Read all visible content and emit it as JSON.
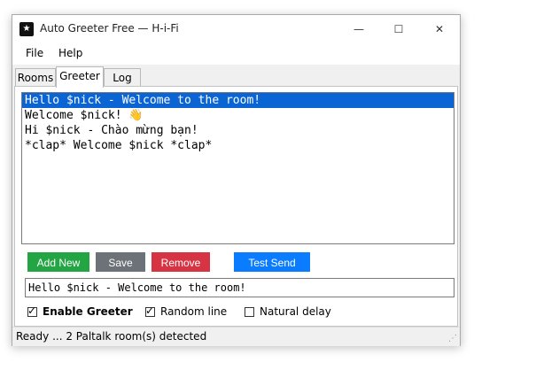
{
  "window": {
    "title": "Auto Greeter Free — H-i-Fi",
    "icon": "app-icon",
    "controls": {
      "minimize": "—",
      "maximize": "☐",
      "close": "✕"
    }
  },
  "menu": {
    "file": "File",
    "help": "Help"
  },
  "tabs": [
    {
      "label": "Rooms",
      "active": false
    },
    {
      "label": "Greeter",
      "active": true
    },
    {
      "label": "Log",
      "active": false
    }
  ],
  "greetings": [
    {
      "text": "Hello $nick - Welcome to the room!",
      "selected": true
    },
    {
      "text": "Welcome $nick! 👋",
      "selected": false
    },
    {
      "text": "Hi $nick - Chào mừng bạn!",
      "selected": false
    },
    {
      "text": "*clap* Welcome $nick *clap*",
      "selected": false
    }
  ],
  "buttons": {
    "add": "Add New",
    "save": "Save",
    "remove": "Remove",
    "test": "Test Send"
  },
  "editor": {
    "value": "Hello $nick - Welcome to the room!"
  },
  "options": {
    "enable_greeter": {
      "label": "Enable Greeter",
      "checked": true
    },
    "random_line": {
      "label": "Random line",
      "checked": true
    },
    "natural_delay": {
      "label": "Natural delay",
      "checked": false
    }
  },
  "status": {
    "text": "Ready ... 2 Paltalk room(s) detected"
  },
  "colors": {
    "selection": "#0a64d4",
    "add_button": "#22a542",
    "save_button": "#6d7278",
    "remove_button": "#d63442",
    "test_button": "#0a7cff"
  }
}
